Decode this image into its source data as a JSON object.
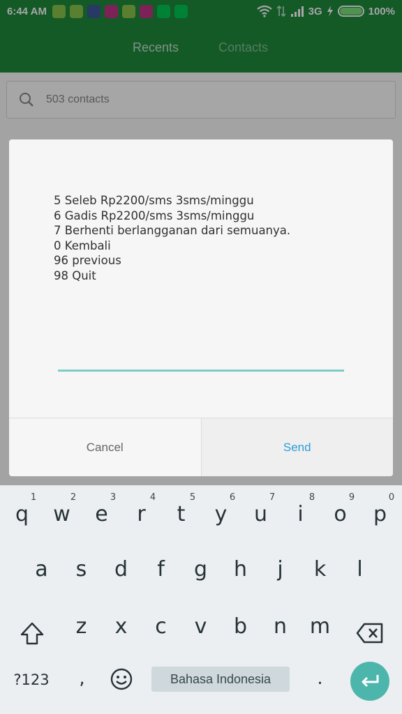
{
  "status_bar": {
    "time": "6:44 AM",
    "network": "3G",
    "battery": "100%",
    "battery_level": 1.0,
    "notification_icons": [
      {
        "name": "android-icon",
        "color": "#8bc34a"
      },
      {
        "name": "android-icon",
        "color": "#8bc34a"
      },
      {
        "name": "facebook-icon",
        "color": "#3b5998"
      },
      {
        "name": "instagram-icon",
        "color": "#c13584"
      },
      {
        "name": "clipboard-icon",
        "color": "#8bc34a"
      },
      {
        "name": "instagram-icon",
        "color": "#c13584"
      },
      {
        "name": "play-store-icon",
        "color": "#00c853"
      },
      {
        "name": "play-store-icon",
        "color": "#00c853"
      }
    ]
  },
  "app_bar": {
    "tabs": [
      "Recents",
      "Contacts"
    ],
    "color": "#1e8a3d"
  },
  "search": {
    "placeholder": "503 contacts"
  },
  "dialog": {
    "lines": [
      "5 Seleb Rp2200/sms 3sms/minggu",
      "6 Gadis Rp2200/sms 3sms/minggu",
      "7 Berhenti berlangganan dari semuanya.",
      "0 Kembali",
      "96 previous",
      "98 Quit"
    ],
    "input_value": "",
    "cancel_label": "Cancel",
    "send_label": "Send",
    "send_color": "#2aa0d8"
  },
  "keyboard": {
    "row1": [
      "q",
      "w",
      "e",
      "r",
      "t",
      "y",
      "u",
      "i",
      "o",
      "p"
    ],
    "row1_hints": [
      "1",
      "2",
      "3",
      "4",
      "5",
      "6",
      "7",
      "8",
      "9",
      "0"
    ],
    "row2": [
      "a",
      "s",
      "d",
      "f",
      "g",
      "h",
      "j",
      "k",
      "l"
    ],
    "row3": [
      "z",
      "x",
      "c",
      "v",
      "b",
      "n",
      "m"
    ],
    "symbols_label": "?123",
    "comma": ",",
    "period": ".",
    "space_label": "Bahasa Indonesia",
    "accent": "#4db6ac"
  }
}
